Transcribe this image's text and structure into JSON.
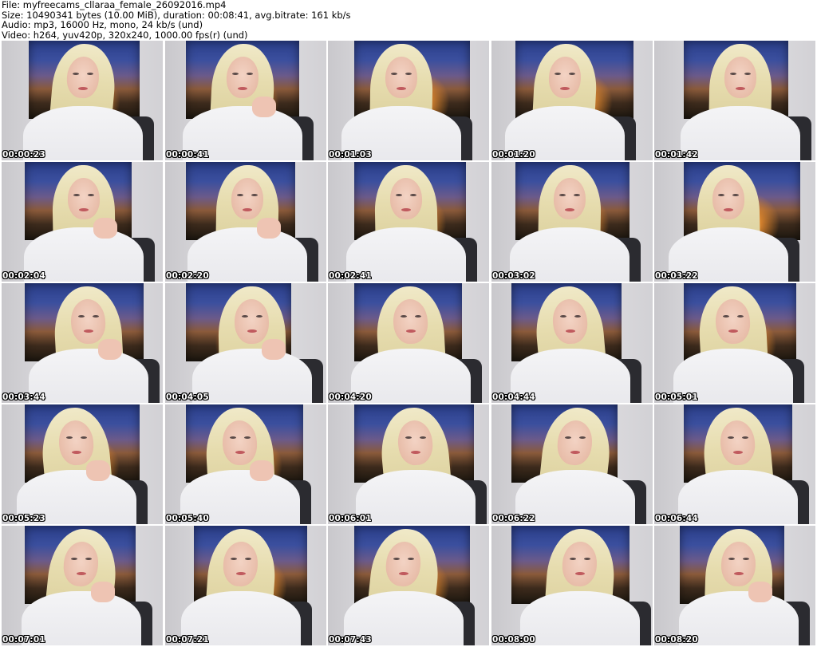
{
  "header": {
    "file": "File: myfreecams_cllaraa_female_26092016.mp4",
    "size": "Size: 10490341 bytes (10.00 MiB), duration: 00:08:41, avg.bitrate: 161 kb/s",
    "audio": "Audio: mp3, 16000 Hz, mono, 24 kb/s (und)",
    "video": "Video: h264, yuv420p, 320x240, 1000.00 fps(r) (und)"
  },
  "thumbnails": [
    {
      "timestamp": "00:00:23"
    },
    {
      "timestamp": "00:00:41"
    },
    {
      "timestamp": "00:01:03"
    },
    {
      "timestamp": "00:01:20"
    },
    {
      "timestamp": "00:01:42"
    },
    {
      "timestamp": "00:02:04"
    },
    {
      "timestamp": "00:02:20"
    },
    {
      "timestamp": "00:02:41"
    },
    {
      "timestamp": "00:03:02"
    },
    {
      "timestamp": "00:03:22"
    },
    {
      "timestamp": "00:03:44"
    },
    {
      "timestamp": "00:04:05"
    },
    {
      "timestamp": "00:04:20"
    },
    {
      "timestamp": "00:04:44"
    },
    {
      "timestamp": "00:05:01"
    },
    {
      "timestamp": "00:05:23"
    },
    {
      "timestamp": "00:05:40"
    },
    {
      "timestamp": "00:06:01"
    },
    {
      "timestamp": "00:06:22"
    },
    {
      "timestamp": "00:06:44"
    },
    {
      "timestamp": "00:07:01"
    },
    {
      "timestamp": "00:07:21"
    },
    {
      "timestamp": "00:07:43"
    },
    {
      "timestamp": "00:08:00"
    },
    {
      "timestamp": "00:08:20"
    }
  ]
}
